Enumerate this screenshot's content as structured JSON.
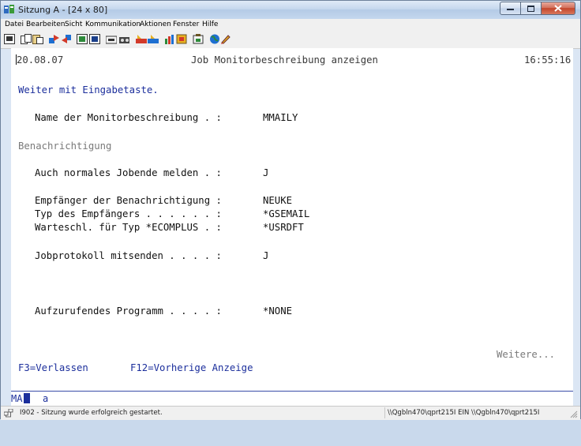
{
  "window": {
    "title": "Sitzung A - [24 x 80]"
  },
  "menu": {
    "items": [
      "Datei",
      "Bearbeiten",
      "Sicht",
      "Kommunikation",
      "Aktionen",
      "Fenster",
      "Hilfe"
    ]
  },
  "toolbar": {
    "icons": [
      "print-screen-icon",
      "copy-icon",
      "paste-icon",
      "send-icon",
      "receive-icon",
      "display-icon",
      "keyboard-icon",
      "macro-icon",
      "record-icon",
      "playback-icon",
      "color-icon",
      "chart-icon",
      "clipboard-icon",
      "globe-icon",
      "edit-icon"
    ]
  },
  "screen": {
    "date": "20.08.07",
    "title": "Job Monitorbeschreibung anzeigen",
    "time": "16:55:16",
    "instruction": "Weiter mit Eingabetaste.",
    "monitor_name_label": "Name der Monitorbeschreibung . :",
    "monitor_name_value": "MMAILY",
    "section_notification": "Benachrichtigung",
    "normal_end_label": "Auch normales Jobende melden . :",
    "normal_end_value": "J",
    "recipient_label": "Empfänger der Benachrichtigung :",
    "recipient_value": "NEUKE",
    "recipient_type_label": "Typ des Empfängers . . . . . . :",
    "recipient_type_value": "*GSEMAIL",
    "queue_label": "Warteschl. für Typ *ECOMPLUS . :",
    "queue_value": "*USRDFT",
    "joblog_label": "Jobprotokoll mitsenden . . . . :",
    "joblog_value": "J",
    "program_label": "Aufzurufendes Programm . . . . :",
    "program_value": "*NONE",
    "more": "Weitere...",
    "f3": "F3=Verlassen",
    "f12": "F12=Vorherige Anzeige"
  },
  "oia": {
    "mode": "MA",
    "indicator": "a"
  },
  "statusbar": {
    "message": "I902 - Sitzung wurde erfolgreich gestartet.",
    "connection": "\\\\Qgbln470\\qprt215I EIN \\\\Qgbln470\\qprt215I"
  },
  "colors": {
    "field_blue": "#1c2f9c",
    "title_grey": "#3a3a3a",
    "section_grey": "#7a7a7a",
    "close_red": "#c3452b"
  }
}
